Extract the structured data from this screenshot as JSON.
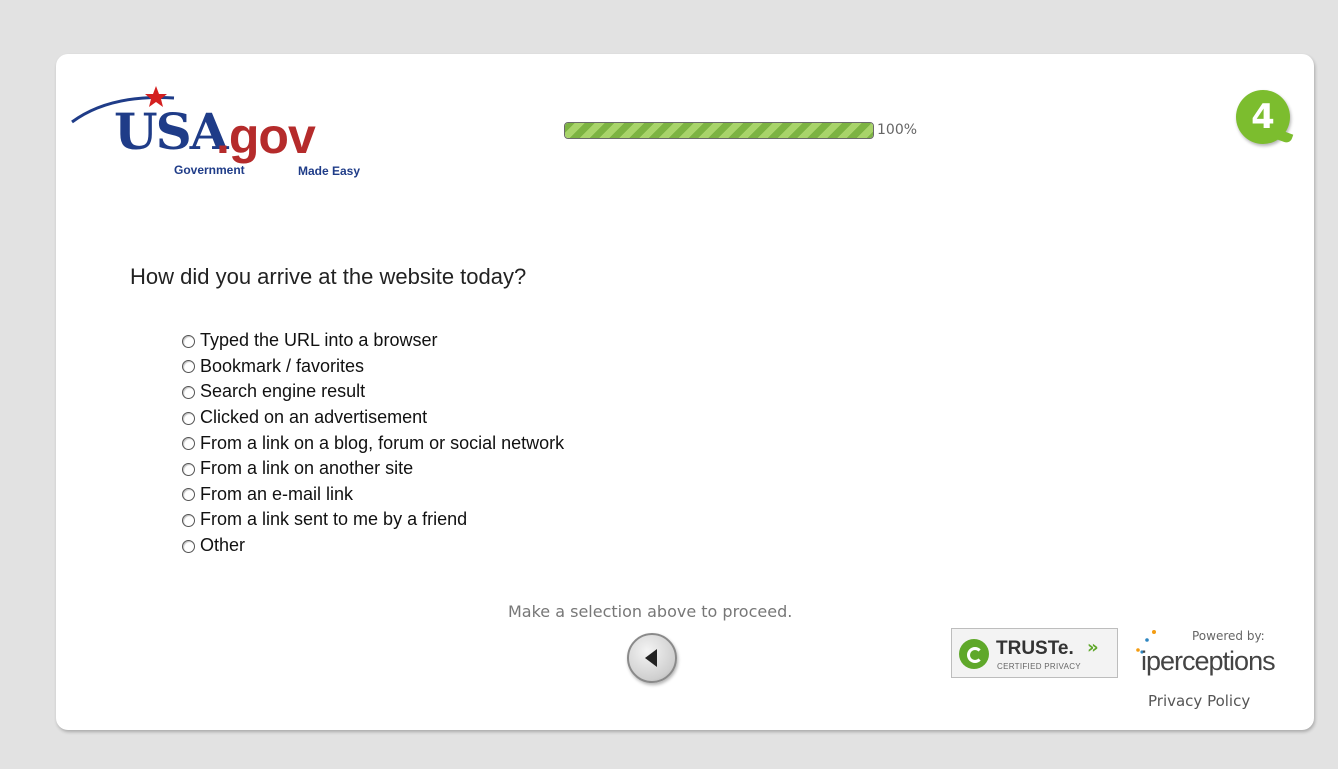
{
  "header": {
    "logo": {
      "main": "USA",
      "dotgov": ".gov",
      "tagline_left": "Government",
      "tagline_right": "Made Easy"
    },
    "progress": {
      "value_percent": 100,
      "label": "100%"
    },
    "badge": {
      "label": "4"
    }
  },
  "question": {
    "text": "How did you arrive at the website today?",
    "options": [
      "Typed the URL into a browser",
      "Bookmark / favorites",
      "Search engine result",
      "Clicked on an advertisement",
      "From a link on a blog, forum or social network",
      "From a link on another site",
      "From an e-mail link",
      "From a link sent to me by a friend",
      "Other"
    ]
  },
  "footer": {
    "hint": "Make a selection above to proceed.",
    "back_icon": "back-arrow-icon",
    "truste": {
      "name": "TRUSTe.",
      "arrows": "»",
      "sub": "CERTIFIED PRIVACY"
    },
    "powered_by": "Powered by:",
    "brand": "iperceptions",
    "privacy": "Privacy Policy"
  },
  "colors": {
    "page_bg": "#e2e2e2",
    "progress_green": "#7cb342",
    "badge_green": "#7cbd2e",
    "usa_blue": "#1f3c88",
    "gov_red": "#b52b2b"
  }
}
